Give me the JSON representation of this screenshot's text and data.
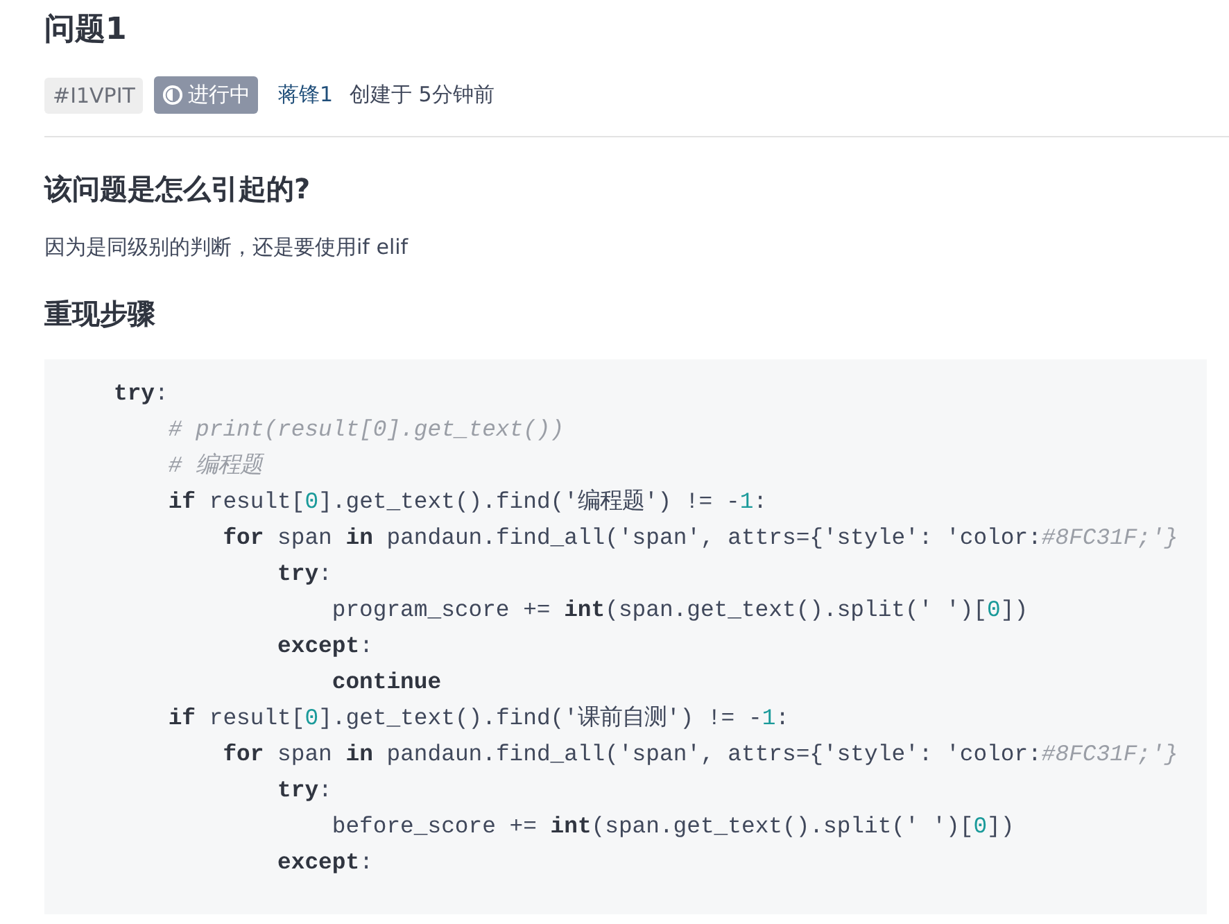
{
  "title": "问题1",
  "meta": {
    "tag": "#I1VPIT",
    "status": {
      "label": "进行中",
      "kind": "in_progress"
    },
    "author": "蒋锋1",
    "created": "创建于 5分钟前"
  },
  "sections": [
    {
      "heading": "该问题是怎么引起的?",
      "body": "因为是同级别的判断，还是要使用if elif"
    },
    {
      "heading": "重现步骤"
    }
  ],
  "code_lines": [
    [
      {
        "kind": "kw",
        "text": "try"
      },
      {
        "kind": "plain",
        "text": ":"
      }
    ],
    [
      {
        "kind": "comment",
        "text": "    # print(result[0].get_text())"
      }
    ],
    [
      {
        "kind": "comment",
        "text": "    # 编程题"
      }
    ],
    [
      {
        "kind": "kw",
        "text": "    if"
      },
      {
        "kind": "plain",
        "text": " result["
      },
      {
        "kind": "num",
        "text": "0"
      },
      {
        "kind": "plain",
        "text": "].get_text().find('编程题') != -"
      },
      {
        "kind": "num",
        "text": "1"
      },
      {
        "kind": "plain",
        "text": ":"
      }
    ],
    [
      {
        "kind": "kw",
        "text": "        for"
      },
      {
        "kind": "plain",
        "text": " span "
      },
      {
        "kind": "kw",
        "text": "in"
      },
      {
        "kind": "plain",
        "text": " pandaun.find_all('span', attrs={'style': 'color:"
      },
      {
        "kind": "comment",
        "text": "#8FC31F;'}"
      }
    ],
    [
      {
        "kind": "kw",
        "text": "            try"
      },
      {
        "kind": "plain",
        "text": ":"
      }
    ],
    [
      {
        "kind": "plain",
        "text": "                program_score += "
      },
      {
        "kind": "kw",
        "text": "int"
      },
      {
        "kind": "plain",
        "text": "(span.get_text().split(' ')["
      },
      {
        "kind": "num",
        "text": "0"
      },
      {
        "kind": "plain",
        "text": "])"
      }
    ],
    [
      {
        "kind": "kw",
        "text": "            except"
      },
      {
        "kind": "plain",
        "text": ":"
      }
    ],
    [
      {
        "kind": "kw",
        "text": "                continue"
      }
    ],
    [
      {
        "kind": "kw",
        "text": "    if"
      },
      {
        "kind": "plain",
        "text": " result["
      },
      {
        "kind": "num",
        "text": "0"
      },
      {
        "kind": "plain",
        "text": "].get_text().find('课前自测') != -"
      },
      {
        "kind": "num",
        "text": "1"
      },
      {
        "kind": "plain",
        "text": ":"
      }
    ],
    [
      {
        "kind": "kw",
        "text": "        for"
      },
      {
        "kind": "plain",
        "text": " span "
      },
      {
        "kind": "kw",
        "text": "in"
      },
      {
        "kind": "plain",
        "text": " pandaun.find_all('span', attrs={'style': 'color:"
      },
      {
        "kind": "comment",
        "text": "#8FC31F;'}"
      }
    ],
    [
      {
        "kind": "kw",
        "text": "            try"
      },
      {
        "kind": "plain",
        "text": ":"
      }
    ],
    [
      {
        "kind": "plain",
        "text": "                before_score += "
      },
      {
        "kind": "kw",
        "text": "int"
      },
      {
        "kind": "plain",
        "text": "(span.get_text().split(' ')["
      },
      {
        "kind": "num",
        "text": "0"
      },
      {
        "kind": "plain",
        "text": "])"
      }
    ],
    [
      {
        "kind": "kw",
        "text": "            except"
      },
      {
        "kind": "plain",
        "text": ":"
      }
    ]
  ]
}
